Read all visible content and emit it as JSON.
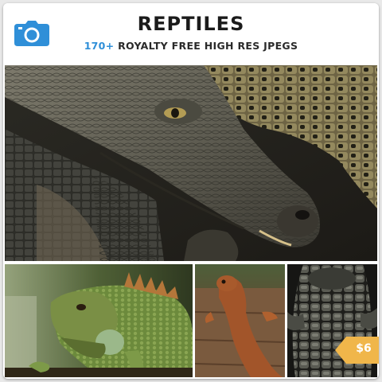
{
  "header": {
    "title": "REPTILES",
    "count": "170+",
    "subtitle_rest": " ROYALTY FREE HIGH RES JPEGS",
    "icon": "camera-icon",
    "icon_color": "#2f8fd8"
  },
  "photos": [
    {
      "name": "crocodile-closeup"
    },
    {
      "name": "green-iguana"
    },
    {
      "name": "brown-lizard-on-wood"
    },
    {
      "name": "crocodile-back-scales"
    }
  ],
  "price": {
    "label": "$6",
    "color": "#f0b64a"
  }
}
